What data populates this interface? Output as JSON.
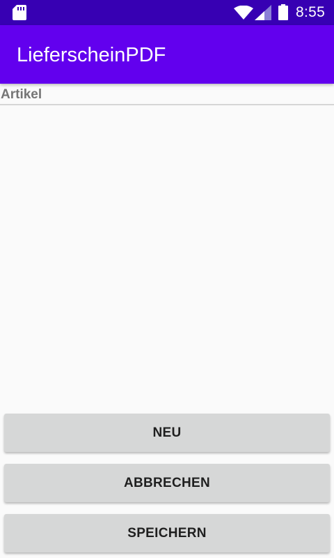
{
  "status_bar": {
    "time": "8:55",
    "icons": [
      "sd-card-icon",
      "wifi-icon",
      "signal-icon",
      "battery-icon"
    ],
    "background": "#3700b3"
  },
  "app_bar": {
    "title": "LieferscheinPDF",
    "background": "#6200ee"
  },
  "section": {
    "label": "Artikel"
  },
  "buttons": {
    "new_label": "NEU",
    "cancel_label": "ABBRECHEN",
    "save_label": "SPEICHERN"
  }
}
